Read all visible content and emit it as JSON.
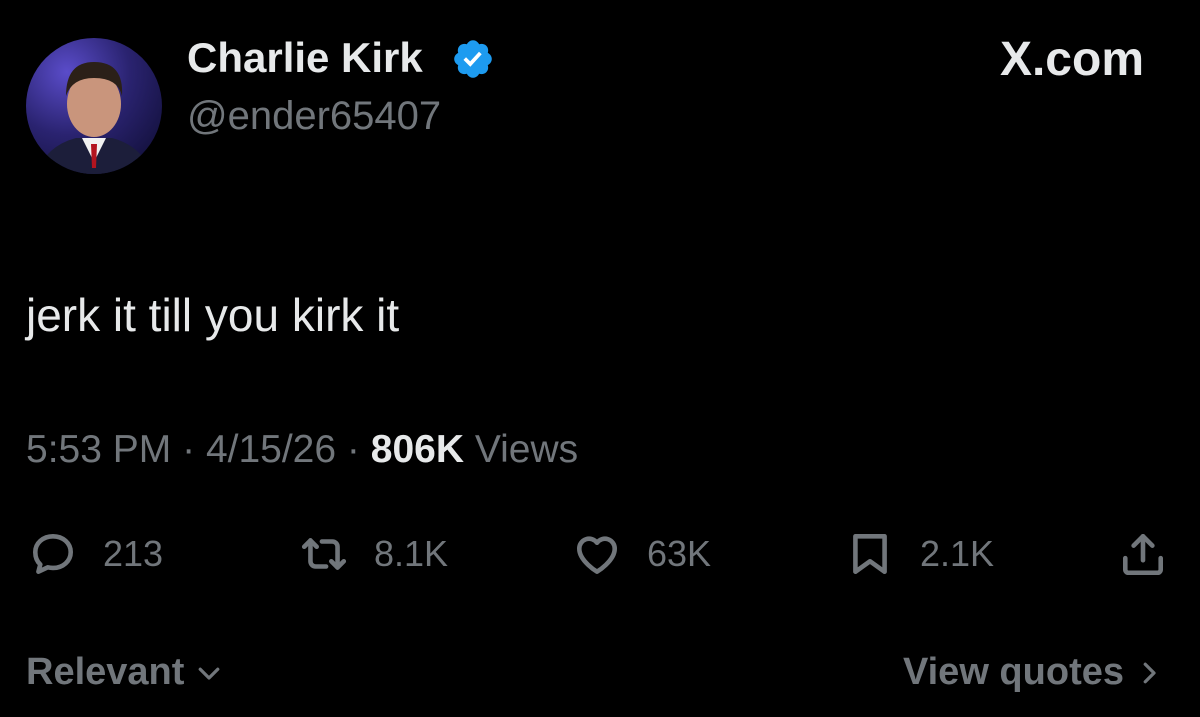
{
  "user": {
    "display_name": "Charlie Kirk",
    "handle": "@ender65407",
    "verified_icon": "verified-badge-icon"
  },
  "brand": {
    "label": "X.com"
  },
  "tweet": {
    "text": "jerk it till you kirk it",
    "time": "5:53 PM",
    "separator": "·",
    "date": "4/15/26",
    "views_count": "806K",
    "views_label": "Views"
  },
  "actions": {
    "replies": "213",
    "reposts": "8.1K",
    "likes": "63K",
    "bookmarks": "2.1K"
  },
  "footer": {
    "sort_label": "Relevant",
    "view_quotes": "View quotes"
  },
  "colors": {
    "background": "#000000",
    "primary_text": "#e7e9ea",
    "secondary_text": "#71767b",
    "verified": "#1d9bf0"
  }
}
